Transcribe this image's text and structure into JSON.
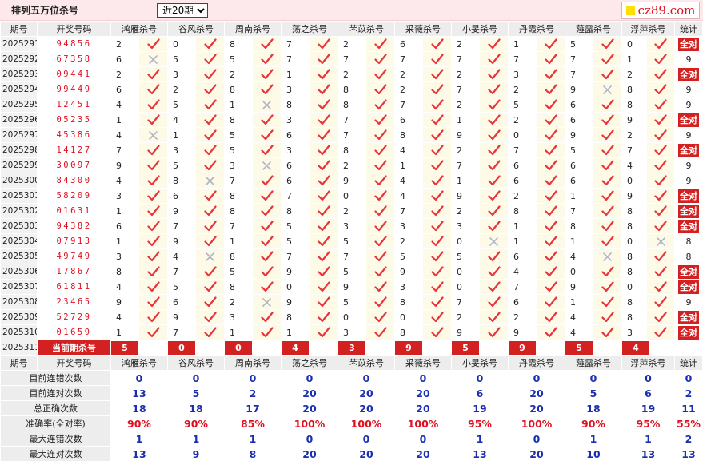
{
  "header": {
    "title": "排列五万位杀号",
    "period_select": {
      "selected": "近20期"
    },
    "logo_text": "cz89.com"
  },
  "table": {
    "period_header": "期号",
    "win_header": "开奖号码",
    "stat_header": "统计",
    "columns": [
      "鸿雁杀号",
      "谷风杀号",
      "周南杀号",
      "荡之杀号",
      "芣苡杀号",
      "采薇杀号",
      "小旻杀号",
      "丹霞杀号",
      "薤露杀号",
      "浮萍杀号"
    ],
    "all_correct_label": "全对",
    "rows": [
      {
        "period": "2025291",
        "win": "94856",
        "kills": [
          "2",
          "0",
          "8",
          "7",
          "2",
          "6",
          "2",
          "1",
          "5",
          "0"
        ],
        "ok": [
          1,
          1,
          1,
          1,
          1,
          1,
          1,
          1,
          1,
          1
        ],
        "stat": "全对"
      },
      {
        "period": "2025292",
        "win": "67358",
        "kills": [
          "6",
          "5",
          "5",
          "7",
          "7",
          "7",
          "7",
          "7",
          "7",
          "1"
        ],
        "ok": [
          0,
          1,
          1,
          1,
          1,
          1,
          1,
          1,
          1,
          1
        ],
        "stat": "9"
      },
      {
        "period": "2025293",
        "win": "09441",
        "kills": [
          "2",
          "3",
          "2",
          "1",
          "2",
          "2",
          "2",
          "3",
          "7",
          "2"
        ],
        "ok": [
          1,
          1,
          1,
          1,
          1,
          1,
          1,
          1,
          1,
          1
        ],
        "stat": "全对"
      },
      {
        "period": "2025294",
        "win": "99449",
        "kills": [
          "6",
          "2",
          "8",
          "3",
          "8",
          "2",
          "7",
          "2",
          "9",
          "8"
        ],
        "ok": [
          1,
          1,
          1,
          1,
          1,
          1,
          1,
          1,
          0,
          1
        ],
        "stat": "9"
      },
      {
        "period": "2025295",
        "win": "12451",
        "kills": [
          "4",
          "5",
          "1",
          "8",
          "8",
          "7",
          "2",
          "5",
          "6",
          "8"
        ],
        "ok": [
          1,
          1,
          0,
          1,
          1,
          1,
          1,
          1,
          1,
          1
        ],
        "stat": "9"
      },
      {
        "period": "2025296",
        "win": "05235",
        "kills": [
          "1",
          "4",
          "8",
          "3",
          "7",
          "6",
          "1",
          "2",
          "6",
          "9"
        ],
        "ok": [
          1,
          1,
          1,
          1,
          1,
          1,
          1,
          1,
          1,
          1
        ],
        "stat": "全对"
      },
      {
        "period": "2025297",
        "win": "45386",
        "kills": [
          "4",
          "1",
          "5",
          "6",
          "7",
          "8",
          "9",
          "0",
          "9",
          "2"
        ],
        "ok": [
          0,
          1,
          1,
          1,
          1,
          1,
          1,
          1,
          1,
          1
        ],
        "stat": "9"
      },
      {
        "period": "2025298",
        "win": "14127",
        "kills": [
          "7",
          "3",
          "5",
          "3",
          "8",
          "4",
          "2",
          "7",
          "5",
          "7"
        ],
        "ok": [
          1,
          1,
          1,
          1,
          1,
          1,
          1,
          1,
          1,
          1
        ],
        "stat": "全对"
      },
      {
        "period": "2025299",
        "win": "30097",
        "kills": [
          "9",
          "5",
          "3",
          "6",
          "2",
          "1",
          "7",
          "6",
          "6",
          "4"
        ],
        "ok": [
          1,
          1,
          0,
          1,
          1,
          1,
          1,
          1,
          1,
          1
        ],
        "stat": "9"
      },
      {
        "period": "2025300",
        "win": "84300",
        "kills": [
          "4",
          "8",
          "7",
          "6",
          "9",
          "4",
          "1",
          "6",
          "6",
          "0"
        ],
        "ok": [
          1,
          0,
          1,
          1,
          1,
          1,
          1,
          1,
          1,
          1
        ],
        "stat": "9"
      },
      {
        "period": "2025301",
        "win": "58209",
        "kills": [
          "3",
          "6",
          "8",
          "7",
          "0",
          "4",
          "9",
          "2",
          "1",
          "9"
        ],
        "ok": [
          1,
          1,
          1,
          1,
          1,
          1,
          1,
          1,
          1,
          1
        ],
        "stat": "全对"
      },
      {
        "period": "2025302",
        "win": "01631",
        "kills": [
          "1",
          "9",
          "8",
          "8",
          "2",
          "7",
          "2",
          "8",
          "7",
          "8"
        ],
        "ok": [
          1,
          1,
          1,
          1,
          1,
          1,
          1,
          1,
          1,
          1
        ],
        "stat": "全对"
      },
      {
        "period": "2025303",
        "win": "94382",
        "kills": [
          "6",
          "7",
          "7",
          "5",
          "3",
          "3",
          "3",
          "1",
          "8",
          "8"
        ],
        "ok": [
          1,
          1,
          1,
          1,
          1,
          1,
          1,
          1,
          1,
          1
        ],
        "stat": "全对"
      },
      {
        "period": "2025304",
        "win": "07913",
        "kills": [
          "1",
          "9",
          "1",
          "5",
          "5",
          "2",
          "0",
          "1",
          "1",
          "0"
        ],
        "ok": [
          1,
          1,
          1,
          1,
          1,
          1,
          0,
          1,
          1,
          0
        ],
        "stat": "8"
      },
      {
        "period": "2025305",
        "win": "49749",
        "kills": [
          "3",
          "4",
          "8",
          "7",
          "7",
          "5",
          "5",
          "6",
          "4",
          "8"
        ],
        "ok": [
          1,
          0,
          1,
          1,
          1,
          1,
          1,
          1,
          0,
          1
        ],
        "stat": "8"
      },
      {
        "period": "2025306",
        "win": "17867",
        "kills": [
          "8",
          "7",
          "5",
          "9",
          "5",
          "9",
          "0",
          "4",
          "0",
          "8"
        ],
        "ok": [
          1,
          1,
          1,
          1,
          1,
          1,
          1,
          1,
          1,
          1
        ],
        "stat": "全对"
      },
      {
        "period": "2025307",
        "win": "61811",
        "kills": [
          "4",
          "5",
          "8",
          "0",
          "9",
          "3",
          "0",
          "7",
          "9",
          "0"
        ],
        "ok": [
          1,
          1,
          1,
          1,
          1,
          1,
          1,
          1,
          1,
          1
        ],
        "stat": "全对"
      },
      {
        "period": "2025308",
        "win": "23465",
        "kills": [
          "9",
          "6",
          "2",
          "9",
          "5",
          "8",
          "7",
          "6",
          "1",
          "8"
        ],
        "ok": [
          1,
          1,
          0,
          1,
          1,
          1,
          1,
          1,
          1,
          1
        ],
        "stat": "9"
      },
      {
        "period": "2025309",
        "win": "52729",
        "kills": [
          "4",
          "9",
          "3",
          "8",
          "0",
          "0",
          "2",
          "2",
          "4",
          "8"
        ],
        "ok": [
          1,
          1,
          1,
          1,
          1,
          1,
          1,
          1,
          1,
          1
        ],
        "stat": "全对"
      },
      {
        "period": "2025310",
        "win": "01659",
        "kills": [
          "1",
          "7",
          "1",
          "1",
          "3",
          "8",
          "9",
          "9",
          "4",
          "3"
        ],
        "ok": [
          1,
          1,
          1,
          1,
          1,
          1,
          1,
          1,
          1,
          1
        ],
        "stat": "全对"
      }
    ],
    "current": {
      "period": "2025311",
      "label": "当前期杀号",
      "kills": [
        "5",
        "0",
        "0",
        "4",
        "3",
        "9",
        "5",
        "9",
        "5",
        "4"
      ]
    },
    "summary": {
      "labels": [
        "目前连错次数",
        "目前连对次数",
        "总正确次数",
        "准确率(全对率)",
        "最大连错次数",
        "最大连对次数"
      ],
      "rows": [
        {
          "values": [
            "0",
            "0",
            "0",
            "0",
            "0",
            "0",
            "0",
            "0",
            "0",
            "0"
          ],
          "stat": "0"
        },
        {
          "values": [
            "13",
            "5",
            "2",
            "20",
            "20",
            "20",
            "6",
            "20",
            "5",
            "6"
          ],
          "stat": "2"
        },
        {
          "values": [
            "18",
            "18",
            "17",
            "20",
            "20",
            "20",
            "19",
            "20",
            "18",
            "19"
          ],
          "stat": "11"
        },
        {
          "values": [
            "90%",
            "90%",
            "85%",
            "100%",
            "100%",
            "100%",
            "95%",
            "100%",
            "90%",
            "95%"
          ],
          "stat": "55%"
        },
        {
          "values": [
            "1",
            "1",
            "1",
            "0",
            "0",
            "0",
            "1",
            "0",
            "1",
            "1"
          ],
          "stat": "2"
        },
        {
          "values": [
            "13",
            "9",
            "8",
            "20",
            "20",
            "20",
            "13",
            "20",
            "10",
            "13"
          ],
          "stat": "13"
        }
      ]
    }
  },
  "colors": {
    "check": "#e8333a",
    "cross": "#b0b4c8",
    "accent_red": "#d32020",
    "summary_blue": "#1a2fb0"
  },
  "icons": {
    "correct": "check-mark-icon",
    "wrong": "cross-mark-icon"
  }
}
